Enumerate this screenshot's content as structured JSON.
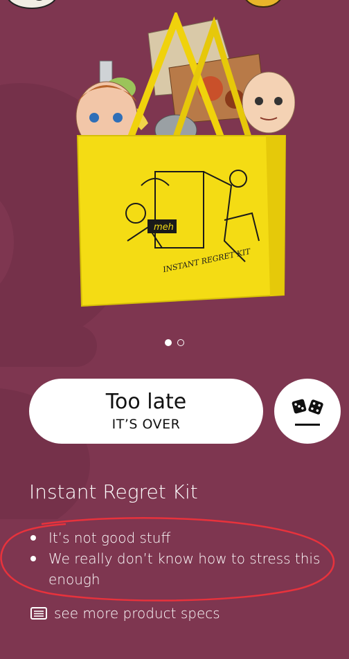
{
  "product": {
    "title": "Instant Regret Kit",
    "image_alt": "Yellow tote bag stuffed with junk, printed with meh logo and the words Instant Regret Kit",
    "bag_print_text": "INSTANT REGRET KIT",
    "bag_logo": "meh"
  },
  "carousel": {
    "total": 2,
    "active": 1
  },
  "buy_button": {
    "title": "Too late",
    "subtitle": "IT’S OVER"
  },
  "dice_button": {
    "icon": "dice-icon"
  },
  "features": [
    "It’s not good stuff",
    "We really don’t know how to stress this enough"
  ],
  "specs_link": {
    "label": "see more product specs",
    "icon": "list-icon"
  },
  "colors": {
    "background": "#7e3650",
    "bag": "#f4dc14",
    "annotation": "#e8323c",
    "button": "#ffffff"
  }
}
